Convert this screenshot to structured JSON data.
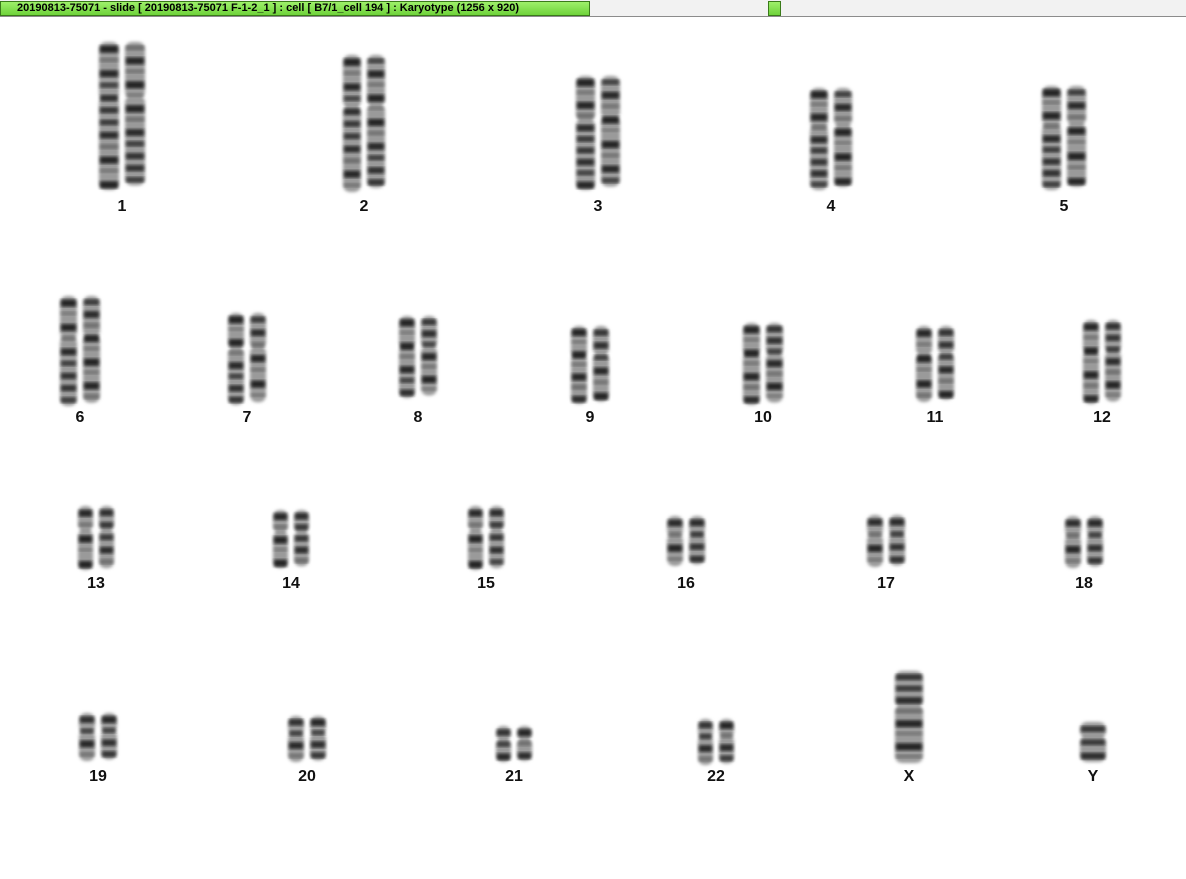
{
  "window": {
    "title": "20190813-75071 - slide [ 20190813-75071 F-1-2_1 ] : cell [ B7/1_cell 194 ] : Karyotype  (1256 x 920)"
  },
  "chromosomes": [
    "1",
    "2",
    "3",
    "4",
    "5",
    "6",
    "7",
    "8",
    "9",
    "10",
    "11",
    "12",
    "13",
    "14",
    "15",
    "16",
    "17",
    "18",
    "19",
    "20",
    "21",
    "22",
    "X",
    "Y"
  ],
  "colors": {
    "accent": "#7ddc4a",
    "chromatin": "#3a3a3a"
  }
}
